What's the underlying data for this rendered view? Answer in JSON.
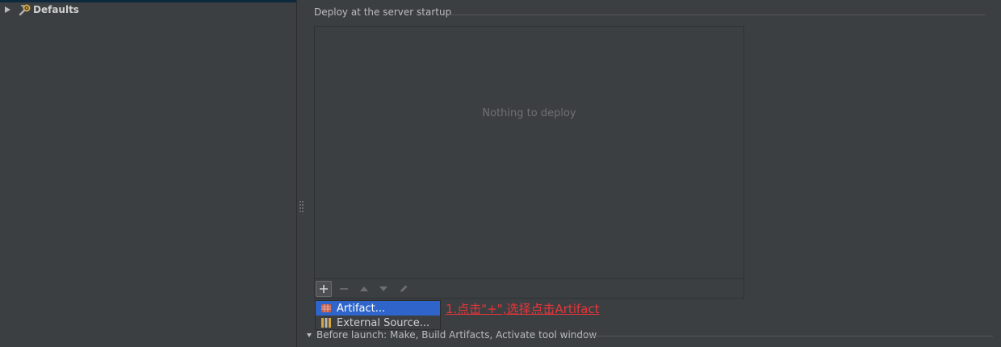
{
  "tree": {
    "items": [
      {
        "label": "Defaults",
        "icon": "wrench-gear-icon",
        "expanded": false
      }
    ]
  },
  "deploy": {
    "section_title": "Deploy at the server startup",
    "empty_text": "Nothing to deploy",
    "toolbar": {
      "add_icon": "plus-icon",
      "remove_icon": "minus-icon",
      "move_up_icon": "arrow-up-icon",
      "move_down_icon": "arrow-down-icon",
      "edit_icon": "pencil-icon"
    }
  },
  "popup_menu": {
    "items": [
      {
        "label": "Artifact...",
        "icon": "artifact-icon",
        "selected": true
      },
      {
        "label": "External Source...",
        "icon": "external-source-icon",
        "selected": false
      }
    ]
  },
  "annotation": {
    "text": "1.点击\"+\",选择点击Artifact",
    "color": "#e8353a"
  },
  "before_launch": {
    "label": "Before launch: Make, Build Artifacts, Activate tool window"
  },
  "colors": {
    "background": "#3c3f41",
    "selection": "#2f65ca",
    "annotation": "#e8353a"
  }
}
